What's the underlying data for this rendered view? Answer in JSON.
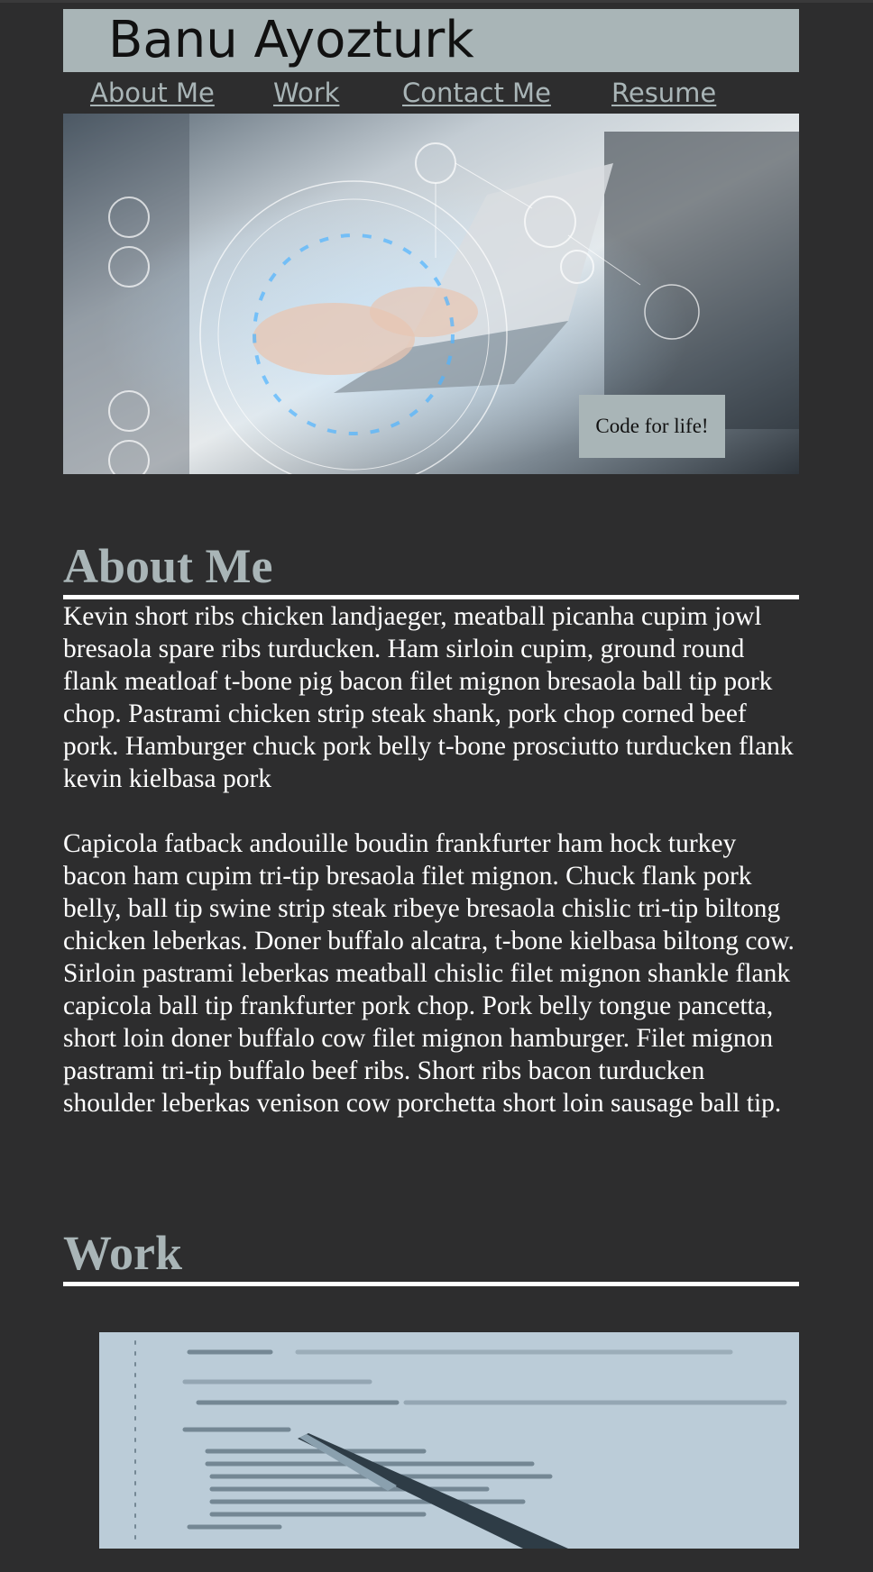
{
  "header": {
    "title": "Banu Ayozturk"
  },
  "nav": {
    "items": [
      {
        "label": "About Me"
      },
      {
        "label": "Work"
      },
      {
        "label": "Contact Me"
      },
      {
        "label": "Resume"
      }
    ]
  },
  "hero": {
    "badge": "Code for life!"
  },
  "about": {
    "title": "About Me",
    "paragraphs": [
      "Kevin short ribs chicken landjaeger, meatball picanha cupim jowl bresaola spare ribs turducken. Ham sirloin cupim, ground round flank meatloaf t-bone pig bacon filet mignon bresaola ball tip pork chop. Pastrami chicken strip steak shank, pork chop corned beef pork. Hamburger chuck pork belly t-bone prosciutto turducken flank kevin kielbasa pork",
      "Capicola fatback andouille boudin frankfurter ham hock turkey bacon ham cupim tri-tip bresaola filet mignon. Chuck flank pork belly, ball tip swine strip steak ribeye bresaola chislic tri-tip biltong chicken leberkas. Doner buffalo alcatra, t-bone kielbasa biltong cow. Sirloin pastrami leberkas meatball chislic filet mignon shankle flank capicola ball tip frankfurter pork chop. Pork belly tongue pancetta, short loin doner buffalo cow filet mignon hamburger. Filet mignon pastrami tri-tip buffalo beef ribs. Short ribs bacon turducken shoulder leberkas venison cow porchetta short loin sausage ball tip."
    ]
  },
  "work": {
    "title": "Work"
  },
  "colors": {
    "background": "#2d2d2e",
    "accent": "#a9b5b7",
    "text": "#ffffff"
  }
}
